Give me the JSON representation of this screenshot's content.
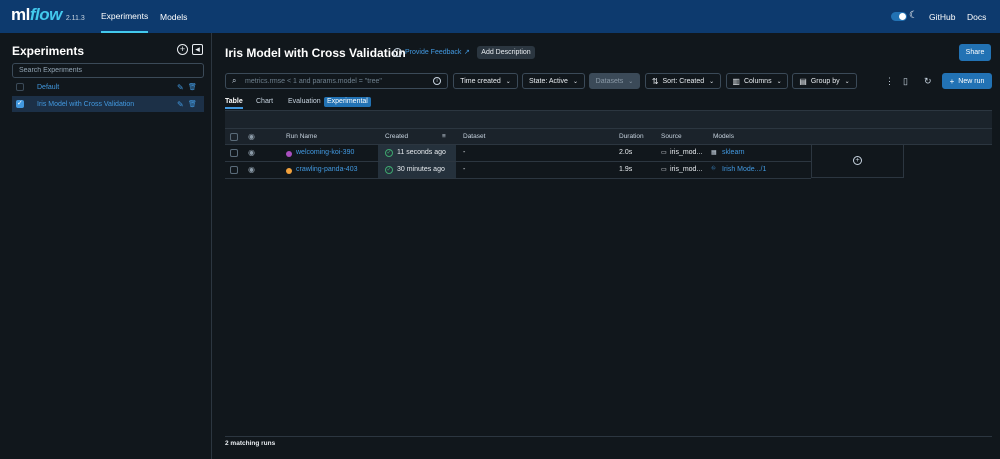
{
  "app": {
    "logo_ml": "ml",
    "logo_flow": "flow",
    "version": "2.11.3"
  },
  "nav": {
    "experiments": "Experiments",
    "models": "Models",
    "github": "GitHub",
    "docs": "Docs"
  },
  "sidebar": {
    "title": "Experiments",
    "search_placeholder": "Search Experiments",
    "items": [
      {
        "label": "Default",
        "selected": false
      },
      {
        "label": "Iris Model with Cross Validation",
        "selected": true
      }
    ]
  },
  "experiment": {
    "title": "Iris Model with Cross Validation",
    "feedback": "Provide Feedback",
    "add_description": "Add Description",
    "share": "Share"
  },
  "toolbar": {
    "filter_placeholder": "metrics.rmse < 1 and params.model = \"tree\"",
    "time_created": "Time created",
    "state": "State: Active",
    "datasets": "Datasets",
    "sort": "Sort: Created",
    "columns": "Columns",
    "group_by": "Group by",
    "new_run": "New run"
  },
  "tabs": {
    "table": "Table",
    "chart": "Chart",
    "evaluation": "Evaluation",
    "experimental": "Experimental"
  },
  "table": {
    "headers": {
      "run_name": "Run Name",
      "created": "Created",
      "dataset": "Dataset",
      "duration": "Duration",
      "source": "Source",
      "models": "Models"
    },
    "rows": [
      {
        "run_name": "welcoming-koi-390",
        "dot_color": "#a94fbf",
        "created": "11 seconds ago",
        "dataset": "-",
        "duration": "2.0s",
        "source": "iris_mod...",
        "models": "sklearn"
      },
      {
        "run_name": "crawling-panda-403",
        "dot_color": "#f2a13c",
        "created": "30 minutes ago",
        "dataset": "-",
        "duration": "1.9s",
        "source": "iris_mod...",
        "models": "Irish Mode.../1"
      }
    ]
  },
  "footer": {
    "matching": "2 matching runs"
  }
}
